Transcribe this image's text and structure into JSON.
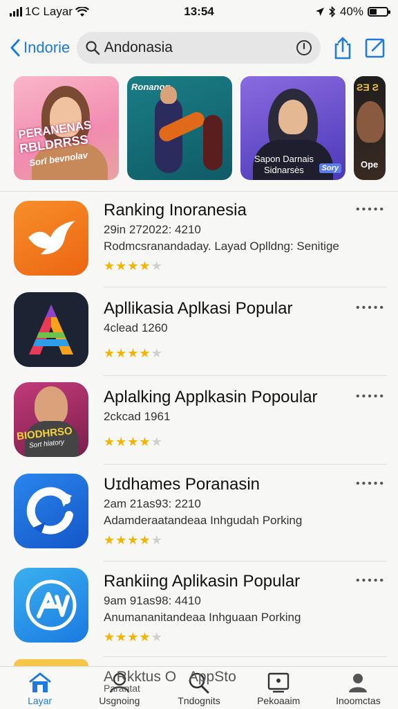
{
  "status_bar": {
    "carrier": "1C Layar",
    "time": "13:54",
    "battery_percent": "40%",
    "battery_level": 0.4
  },
  "nav": {
    "back_label": "Indorie",
    "search_value": "Andonasia"
  },
  "banners": [
    {
      "text_lines": [
        "PERANENAS",
        "RBLDRRSS",
        "Sorī bevnolav"
      ]
    },
    {
      "text_lines": [
        "Ronanog"
      ]
    },
    {
      "text_lines": [
        "Sapon Darnais",
        "Sidnarsės",
        "Sory"
      ]
    },
    {
      "text_lines": [
        "ƧƎ Ƨ",
        "Ope"
      ]
    }
  ],
  "list": [
    {
      "title": "Ranking Inoranesia",
      "subtitle": "29in 272022: 4210",
      "description": "Rodmcsranandaday. Layad Oplldng: Senitige",
      "rating": 4,
      "icon": "bird-icon",
      "color": "#f07a1a"
    },
    {
      "title": "Apllikasia Aplkasi Popular",
      "subtitle": "4clead 1260",
      "description": "",
      "rating": 4,
      "icon": "letter-a-icon",
      "color": "#1c2333"
    },
    {
      "title": "Aplalking Applkasin Popoular",
      "subtitle": "2ckcad 1961",
      "description": "",
      "rating": 4,
      "icon": "person-poster-icon",
      "color": "#a0306a",
      "icon_text": [
        "BIODHRSO",
        "Sort hlatory"
      ]
    },
    {
      "title": "Uɪdhames Poranasin",
      "subtitle": "2am 21as93: 2210",
      "description": "Adamderaatandeaa Inhgudah Porking",
      "rating": 4,
      "icon": "refresh-icon",
      "color": "#1a73e0"
    },
    {
      "title": "Rankiing Aplikasin Popular",
      "subtitle": "9am 91as98: 4410",
      "description": "Anumananitandeaa Inhguaan Porking",
      "rating": 4,
      "icon": "av-circle-icon",
      "color": "#1c8fe6"
    }
  ],
  "more_label": "•••••",
  "ghost_text": [
    "A Rkktus O",
    "AppSto",
    "Parantat"
  ],
  "tabs": [
    {
      "label": "Layar",
      "icon": "home-icon",
      "active": true
    },
    {
      "label": "Usgnoing",
      "icon": "people-icon",
      "active": false
    },
    {
      "label": "Tndognits",
      "icon": "search-icon",
      "active": false
    },
    {
      "label": "Pekoaaim",
      "icon": "monitor-icon",
      "active": false
    },
    {
      "label": "Inoomctas",
      "icon": "profile-icon",
      "active": false
    }
  ],
  "colors": {
    "accent": "#1f7ae0",
    "star": "#f3b400"
  }
}
